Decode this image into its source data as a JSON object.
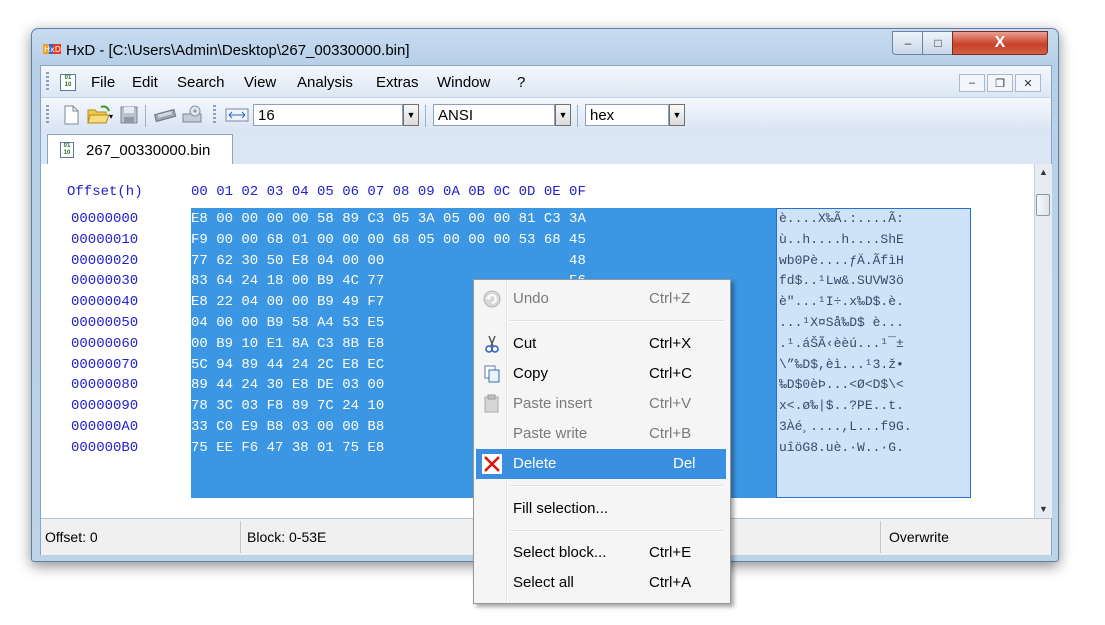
{
  "window": {
    "title": "HxD - [C:\\Users\\Admin\\Desktop\\267_00330000.bin]",
    "controls": {
      "minimize": "–",
      "maximize": "□",
      "close": "X"
    }
  },
  "menu": {
    "items": [
      "File",
      "Edit",
      "Search",
      "View",
      "Analysis",
      "Extras",
      "Window",
      "?"
    ],
    "mdi_controls": {
      "minimize": "–",
      "restore": "❐",
      "close": "✕"
    }
  },
  "toolbar": {
    "bytes_per_row": "16",
    "charset": "ANSI",
    "offset_base": "hex"
  },
  "tabs": [
    {
      "label": "267_00330000.bin"
    }
  ],
  "hex_view": {
    "offset_header": "Offset(h)",
    "column_header": "00 01 02 03 04 05 06 07 08 09 0A 0B 0C 0D 0E 0F",
    "offsets": [
      "00000000",
      "00000010",
      "00000020",
      "00000030",
      "00000040",
      "00000050",
      "00000060",
      "00000070",
      "00000080",
      "00000090",
      "000000A0",
      "000000B0"
    ],
    "hex_rows": [
      "E8 00 00 00 00 58 89 C3 05 3A 05 00 00 81 C3 3A",
      "F9 00 00 68 01 00 00 00 68 05 00 00 00 53 68 45",
      "77 62 30 50 E8 04 00 00                      48",
      "83 64 24 18 00 B9 4C 77                      F6",
      "E8 22 04 00 00 B9 49 F7                      14",
      "04 00 00 B9 58 A4 53 E5                      00",
      "00 B9 10 E1 8A C3 8B E8                      B1",
      "5C 94 89 44 24 2C E8 EC                      95",
      "89 44 24 30 E8 DE 03 00                      8B",
      "78 3C 03 F8 89 7C 24 10                      07",
      "33 C0 E9 B8 03 00 00 B8                      04",
      "75 EE F6 47 38 01 75 E8                      14"
    ],
    "ascii_rows": [
      "è....X‰Ã.:....Ã:",
      "ù..h....h....ShE",
      "wb0Pè....ƒÄ.ÃfìH",
      "fd$..¹Lw&.SUVW3ö",
      "è\"...¹I÷.x‰D$.è.",
      "...¹X¤Så‰D$ è...",
      ".¹.áŠÃ‹èèú...¹¯±",
      "\\”‰D$,èì...¹3.ž•",
      "‰D$0èÞ...<Ø<D$\\<",
      "x<.ø‰|$..?PE..t.",
      "3Àé¸....,L...f9G.",
      "uîöG8.uè.·W..·G."
    ]
  },
  "status": {
    "offset": "Offset: 0",
    "block": "Block: 0-53E",
    "mode": "Overwrite"
  },
  "context_menu": {
    "items": [
      {
        "label": "Undo",
        "shortcut": "Ctrl+Z",
        "icon": "undo-icon",
        "enabled": false
      },
      {
        "label": "Cut",
        "shortcut": "Ctrl+X",
        "icon": "scissors-icon",
        "enabled": true
      },
      {
        "label": "Copy",
        "shortcut": "Ctrl+C",
        "icon": "copy-icon",
        "enabled": true
      },
      {
        "label": "Paste insert",
        "shortcut": "Ctrl+V",
        "icon": "clipboard-icon",
        "enabled": false
      },
      {
        "label": "Paste write",
        "shortcut": "Ctrl+B",
        "icon": "",
        "enabled": false
      },
      {
        "label": "Delete",
        "shortcut": "Del",
        "icon": "delete-x-icon",
        "enabled": true,
        "highlighted": true
      },
      {
        "label": "Fill selection...",
        "shortcut": "",
        "icon": "",
        "enabled": true
      },
      {
        "label": "Select block...",
        "shortcut": "Ctrl+E",
        "icon": "",
        "enabled": true
      },
      {
        "label": "Select all",
        "shortcut": "Ctrl+A",
        "icon": "",
        "enabled": true
      }
    ]
  },
  "colors": {
    "selection_hex": "#3b96e4",
    "selection_ascii": "#cfe3f8",
    "offset_text": "#1f1fd0",
    "menu_highlight": "#3b8fe0"
  }
}
